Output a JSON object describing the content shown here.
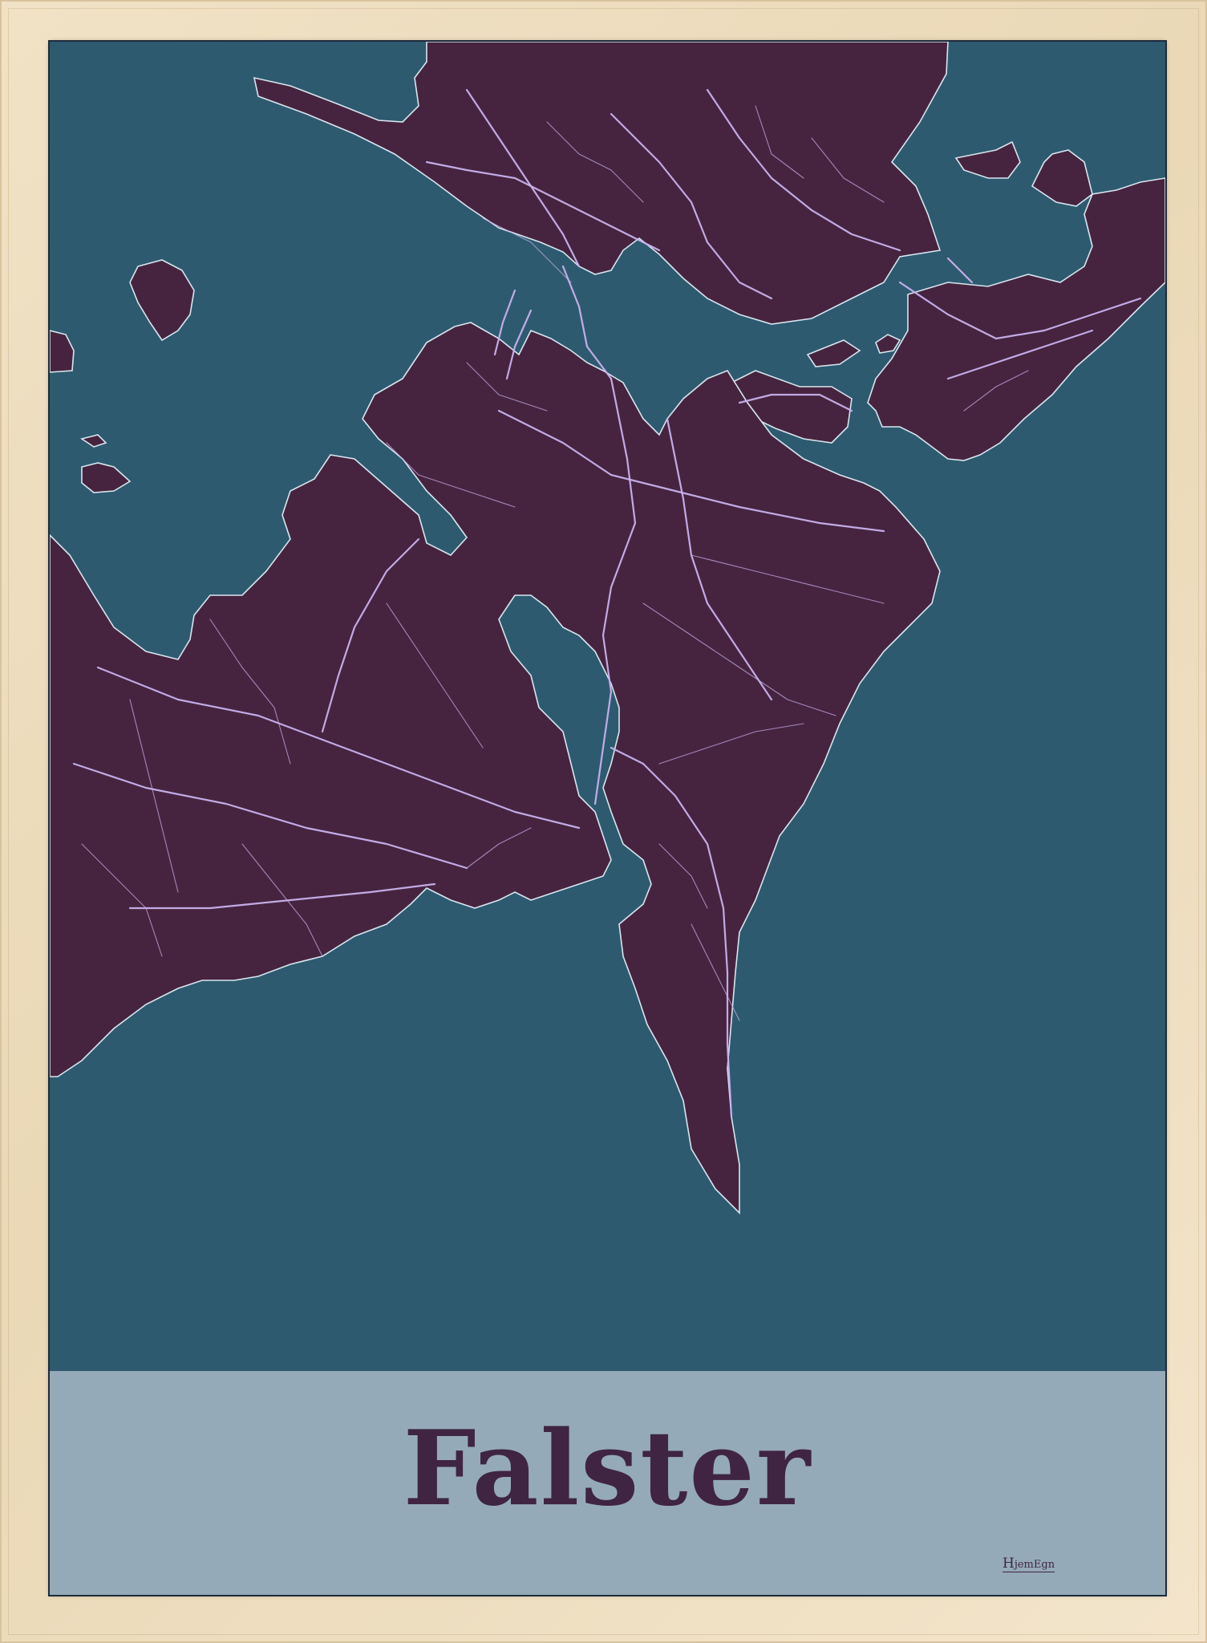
{
  "poster": {
    "title": "Falster",
    "brand": "HjemEgn",
    "brand_cap": "H",
    "brand_rest": "jemEgn"
  },
  "colors": {
    "frame": "#ead8b6",
    "water": "#2e5a70",
    "land": "#46243f",
    "land_light": "#5a2c52",
    "roads": "#c9b2ee",
    "coast": "#d8e6ee",
    "title_band": "#95aab8",
    "title_text": "#3f2541"
  }
}
